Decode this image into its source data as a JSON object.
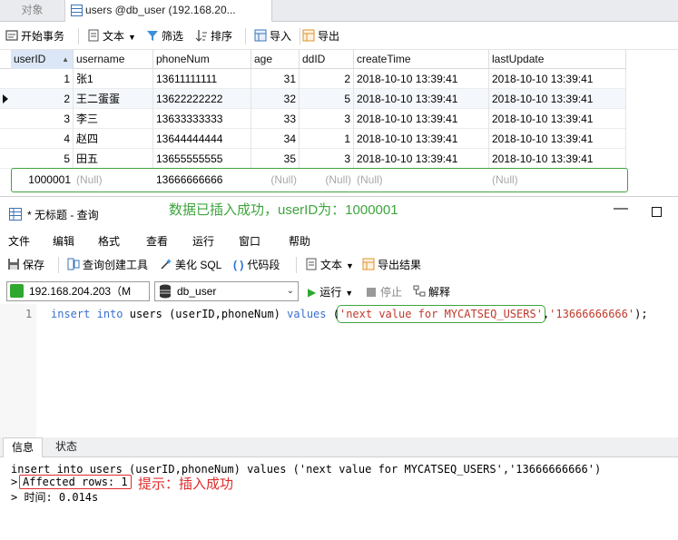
{
  "tabs": {
    "objects": "对象",
    "table": "users @db_user (192.168.20..."
  },
  "toolbar": {
    "begin_transaction": "开始事务",
    "text": "文本",
    "filter": "筛选",
    "sort": "排序",
    "import": "导入",
    "export": "导出"
  },
  "grid": {
    "columns": [
      "userID",
      "username",
      "phoneNum",
      "age",
      "ddID",
      "createTime",
      "lastUpdate"
    ],
    "rows": [
      [
        "1",
        "张1",
        "13611111111",
        "31",
        "2",
        "2018-10-10 13:39:41",
        "2018-10-10 13:39:41"
      ],
      [
        "2",
        "王二蛋蛋",
        "13622222222",
        "32",
        "5",
        "2018-10-10 13:39:41",
        "2018-10-10 13:39:41"
      ],
      [
        "3",
        "李三",
        "13633333333",
        "33",
        "3",
        "2018-10-10 13:39:41",
        "2018-10-10 13:39:41"
      ],
      [
        "4",
        "赵四",
        "13644444444",
        "34",
        "1",
        "2018-10-10 13:39:41",
        "2018-10-10 13:39:41"
      ],
      [
        "5",
        "田五",
        "13655555555",
        "35",
        "3",
        "2018-10-10 13:39:41",
        "2018-10-10 13:39:41"
      ]
    ],
    "new_row": [
      "1000001",
      "(Null)",
      "13666666666",
      "(Null)",
      "(Null)",
      "(Null)",
      "(Null)"
    ]
  },
  "annotations": {
    "insert_success": "数据已插入成功，userID为：1000001",
    "hint": "提示：插入成功"
  },
  "query_window": {
    "title": "* 无标题 - 查询",
    "menu": [
      "文件",
      "编辑",
      "格式",
      "查看",
      "运行",
      "窗口",
      "帮助"
    ],
    "toolbar": {
      "save": "保存",
      "query_builder": "查询创建工具",
      "beautify": "美化 SQL",
      "snippet": "代码段",
      "text": "文本",
      "export_result": "导出结果"
    },
    "connection": "192.168.204.203（M",
    "database": "db_user",
    "run": "运行",
    "stop": "停止",
    "explain": "解释",
    "line_number": "1",
    "code": {
      "kw_insert": "insert",
      "kw_into": "into",
      "table_part": "users (userID,phoneNum)",
      "kw_values": "values",
      "open": "(",
      "str1": "'next value for MYCATSEQ_USERS'",
      "comma": ",",
      "str2": "'13666666666'",
      "close": ");"
    }
  },
  "bottom": {
    "tab_info": "信息",
    "tab_status": "状态",
    "line1": "insert into users (userID,phoneNum) values ('next value for MYCATSEQ_USERS','13666666666')",
    "prompt": ">",
    "affected": "Affected rows: 1",
    "line3": "> 时间: 0.014s"
  },
  "colors": {
    "annotation_green": "#3ea43e",
    "annotation_red": "#e02b2b",
    "run_green": "#2fa82f"
  }
}
